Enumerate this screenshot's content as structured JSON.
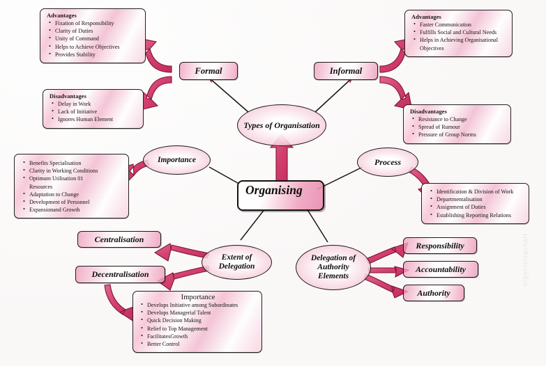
{
  "diagram": {
    "title": "Organising",
    "watermark": "organisingchart",
    "center": {
      "label": "Organising"
    },
    "ovals": {
      "types": "Types of Organisation",
      "importance": "Importance",
      "process": "Process",
      "extent": "Extent of Delegation",
      "delegation": "Delegation of Authority Elements"
    },
    "pills": {
      "formal": "Formal",
      "informal": "Informal",
      "centralisation": "Centralisation",
      "decentralisation": "Decentralisation",
      "responsibility": "Responsibility",
      "accountability": "Accountability",
      "authority": "Authority"
    },
    "boxes": {
      "formal_advantages": {
        "heading": "Advantages",
        "items": [
          "Fixation of Responsibility",
          "Clarity of Duties",
          "Unity of Command",
          "Helps to Achieve Objectives",
          "Provides Stability"
        ]
      },
      "formal_disadvantages": {
        "heading": "Disadvantages",
        "items": [
          "Delay in Work",
          "Lack of Initiative",
          "Ignores Human Element"
        ]
      },
      "informal_advantages": {
        "heading": "Advantages",
        "items": [
          "Faster Communication",
          "Fulfills Social and Cultural Needs",
          "Helps in Achieving Organisational Objectives"
        ]
      },
      "informal_disadvantages": {
        "heading": "Disadvantages",
        "items": [
          "Resistance to Change",
          "Spread of Rumour",
          "Pressure of Group Norms"
        ]
      },
      "importance_list": {
        "heading": "",
        "items": [
          "Benefits Specialisation",
          "Clarity in Working Conditions",
          "Optimum Utilisation 01 Resources",
          "Adaptation to Change",
          "Development of Personnel",
          "Expansionand Growth"
        ]
      },
      "process_list": {
        "heading": "",
        "items": [
          "Identification & Division of Work",
          "Departmentalisation",
          "Assignment of Duties",
          "Establishing Reporting Relations"
        ]
      },
      "delegation_importance": {
        "heading": "Importance",
        "items": [
          "Develops Initiative among Subordinates",
          "Develops Managerial Talent",
          "Quick Decision Making",
          "Relief to Top Management",
          "FacilitatesGrowth",
          "Better Control"
        ]
      }
    },
    "colors": {
      "arrow_fill": "#d94b77",
      "arrow_stroke": "#7d1634",
      "ink": "#16130f",
      "wash": "#f0a0c0"
    }
  }
}
